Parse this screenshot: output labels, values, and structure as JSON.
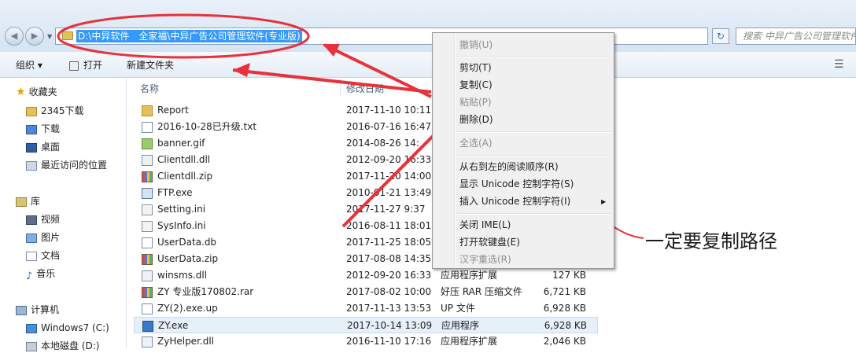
{
  "address": {
    "path": "D:\\中异软件　全家福\\中异广告公司管理软件(专业版)"
  },
  "search": {
    "placeholder": "搜索 中异广告公司管理软件"
  },
  "toolbar": {
    "organize": "组织 ▾",
    "open": "打开",
    "new_folder": "新建文件夹"
  },
  "sidebar": {
    "favorites": "收藏夹",
    "fav_items": [
      "2345下载",
      "下载",
      "桌面",
      "最近访问的位置"
    ],
    "library": "库",
    "lib_items": [
      "视频",
      "图片",
      "文档",
      "音乐"
    ],
    "computer": "计算机",
    "drives": [
      "Windows7 (C:)",
      "本地磁盘 (D:)"
    ]
  },
  "columns": {
    "name": "名称",
    "date": "修改日期"
  },
  "files": [
    {
      "name": "Report",
      "date": "2017-11-10 10:11",
      "type": "",
      "size": "",
      "icon": "folder"
    },
    {
      "name": "2016-10-28已升级.txt",
      "date": "2016-07-16 16:47",
      "type": "",
      "size": "",
      "icon": "file"
    },
    {
      "name": "banner.gif",
      "date": "2014-08-26 14:",
      "type": "",
      "size": "",
      "icon": "gif"
    },
    {
      "name": "Clientdll.dll",
      "date": "2012-09-20 16:33",
      "type": "",
      "size": "",
      "icon": "dll"
    },
    {
      "name": "Clientdll.zip",
      "date": "2017-11-20 14:00",
      "type": "",
      "size": "",
      "icon": "zip"
    },
    {
      "name": "FTP.exe",
      "date": "2010-01-21 13:49",
      "type": "",
      "size": "",
      "icon": "exe"
    },
    {
      "name": "Setting.ini",
      "date": "2017-11-27 9:37",
      "type": "",
      "size": "",
      "icon": "ini"
    },
    {
      "name": "SysInfo.ini",
      "date": "2016-08-11 18:01",
      "type": "",
      "size": "",
      "icon": "ini"
    },
    {
      "name": "UserData.db",
      "date": "2017-11-25 18:05",
      "type": "",
      "size": "",
      "icon": "file"
    },
    {
      "name": "UserData.zip",
      "date": "2017-08-08 14:35",
      "type": "",
      "size": "",
      "icon": "zip"
    },
    {
      "name": "winsms.dll",
      "date": "2012-09-20 16:33",
      "type": "应用程序扩展",
      "size": "127 KB",
      "icon": "dll"
    },
    {
      "name": "ZY 专业版170802.rar",
      "date": "2017-08-02 10:00",
      "type": "好压 RAR 压缩文件",
      "size": "6,721 KB",
      "icon": "zip"
    },
    {
      "name": "ZY(2).exe.up",
      "date": "2017-11-13 13:53",
      "type": "UP 文件",
      "size": "6,928 KB",
      "icon": "file"
    },
    {
      "name": "ZY.exe",
      "date": "2017-10-14 13:09",
      "type": "应用程序",
      "size": "6,928 KB",
      "icon": "zy"
    },
    {
      "name": "ZyHelper.dll",
      "date": "2016-11-10 17:16",
      "type": "应用程序扩展",
      "size": "2,046 KB",
      "icon": "dll"
    }
  ],
  "context_menu": {
    "undo": "撤销(U)",
    "cut": "剪切(T)",
    "copy": "复制(C)",
    "paste": "粘贴(P)",
    "delete": "删除(D)",
    "select_all": "全选(A)",
    "rtl": "从右到左的阅读顺序(R)",
    "show_unicode": "显示 Unicode 控制字符(S)",
    "insert_unicode": "插入 Unicode 控制字符(I)",
    "close_ime": "关闭 IME(L)",
    "soft_keyboard": "打开软键盘(E)",
    "reconvert": "汉字重选(R)"
  },
  "annotation": {
    "text": "一定要复制路径",
    "color": "#e8313a"
  }
}
